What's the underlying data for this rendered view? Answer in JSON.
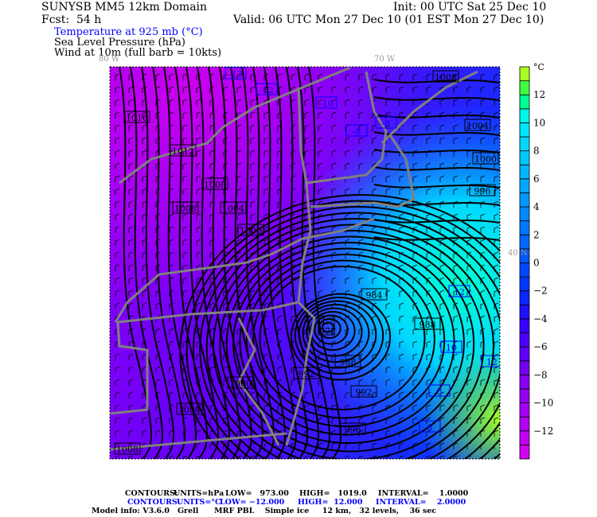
{
  "header": {
    "title": "SUNYSB MM5 12km Domain",
    "init": "Init: 00 UTC Sat 25 Dec 10",
    "forecast": "Fcst:  54 h",
    "valid": "Valid: 06 UTC Mon 27 Dec 10 (01 EST Mon 27 Dec 10)",
    "fields": [
      "Temperature at 925 mb (°C)",
      "Sea Level Pressure (hPa)",
      "Wind at 10m (full barb = 10kts)"
    ]
  },
  "map": {
    "lon_labels": [
      "80 W",
      "70 W"
    ],
    "lat_labels": [
      "40 N"
    ],
    "low": {
      "symbol": "L",
      "value": "972"
    },
    "pressure_labels": [
      "1016",
      "1012",
      "1008",
      "1008",
      "1004",
      "1000",
      "1008",
      "1004",
      "1000",
      "996",
      "984",
      "988",
      "988",
      "992",
      "992",
      "996",
      "1000",
      "1004",
      "1008"
    ],
    "temperature_labels": [
      "-13",
      "-12",
      "-10",
      "-8",
      "-8",
      "12",
      "10",
      "12",
      "8",
      "6"
    ],
    "colors": {
      "state_lines": "#808080",
      "isobars": "#000000",
      "isotherms": "#0000ff"
    }
  },
  "colorbar": {
    "unit": "°C",
    "ticks": [
      "12",
      "10",
      "8",
      "6",
      "4",
      "2",
      "0",
      "-2",
      "-4",
      "-6",
      "-8",
      "-10",
      "-12"
    ],
    "range": [
      -14,
      14
    ],
    "colors": [
      "#d000f0",
      "#c400f4",
      "#b400f4",
      "#a400f4",
      "#9600f4",
      "#8800f4",
      "#7400f4",
      "#6000f8",
      "#4c00fc",
      "#3800ff",
      "#2010ff",
      "#0828ff",
      "#0038ff",
      "#0048ff",
      "#0058ff",
      "#0068ff",
      "#0078ff",
      "#0088ff",
      "#0098ff",
      "#00a8ff",
      "#00b8ff",
      "#00c8ff",
      "#00d8ff",
      "#00e8ff",
      "#00f8e8",
      "#00ff90",
      "#40ff40",
      "#a8ff20"
    ]
  },
  "footer": {
    "slp": {
      "label": "CONTOURS:",
      "units": "UNITS=hPa",
      "low": "LOW=   973.00",
      "high": "HIGH=   1019.0",
      "interval": "INTERVAL=    1.0000"
    },
    "temp": {
      "label": "CONTOURS:",
      "units": "UNITS=°C",
      "low": "LOW= −12.000",
      "high": "HIGH=  12.000",
      "interval": "INTERVAL=    2.0000"
    },
    "model": "Model info: V3.6.0   Grell      MRF PBL    Simple ice     12 km,   32 levels,    36 sec"
  }
}
